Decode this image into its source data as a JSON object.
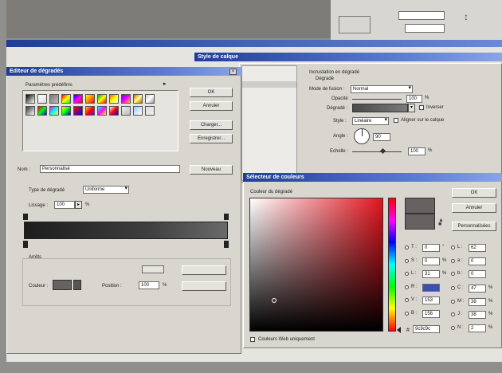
{
  "gradient_editor": {
    "title": "Editeur de dégradés",
    "presets_label": "Paramètres prédéfinis",
    "buttons": {
      "ok": "OK",
      "cancel": "Annuler",
      "load": "Charger...",
      "save": "Enregistrer..."
    },
    "name_label": "Nom :",
    "name_value": "Personnalisé",
    "new_button": "Nouveau",
    "gradient_type_label": "Type de dégradé",
    "gradient_type_value": "Uniforme",
    "smoothness_label": "Lissage :",
    "smoothness_value": "100",
    "smoothness_unit": "%",
    "stops_label": "Arrêts",
    "color_label": "Couleur :",
    "position_label": "Position :",
    "position_value": "100",
    "position_unit": "%"
  },
  "layer_style": {
    "title": "Style de calque",
    "section_title": "Incrustation en dégradé",
    "sub_title": "Dégradé",
    "blend_label": "Mode de fusion :",
    "blend_value": "Normal",
    "opacity_label": "Opacité :",
    "opacity_value": "100",
    "opacity_unit": "%",
    "gradient_label": "Dégradé :",
    "reverse_label": "Inverser",
    "style_label": "Style :",
    "style_value": "Linéaire",
    "align_label": "Aligner sur le calque",
    "angle_label": "Angle :",
    "angle_value": "90",
    "scale_label": "Echelle :",
    "scale_value": "100",
    "scale_unit": "%"
  },
  "color_picker": {
    "title": "Sélecteur de couleurs",
    "subtitle": "Couleur du dégradé",
    "buttons": {
      "ok": "OK",
      "cancel": "Annuler",
      "custom": "Personnalisées"
    },
    "web_only_label": "Couleurs Web uniquement",
    "fields": {
      "H": {
        "label": "T :",
        "value": "0",
        "unit": "°"
      },
      "S": {
        "label": "S :",
        "value": "0",
        "unit": "%"
      },
      "B": {
        "label": "L :",
        "value": "31",
        "unit": "%"
      },
      "R": {
        "label": "R :",
        "value": "",
        "unit": ""
      },
      "G": {
        "label": "V :",
        "value": "153",
        "unit": ""
      },
      "Bl": {
        "label": "B :",
        "value": "156",
        "unit": ""
      },
      "L": {
        "label": "L :",
        "value": "62",
        "unit": ""
      },
      "a": {
        "label": "a :",
        "value": "0",
        "unit": ""
      },
      "b": {
        "label": "b :",
        "value": "0",
        "unit": ""
      },
      "C": {
        "label": "C :",
        "value": "47",
        "unit": "%"
      },
      "M": {
        "label": "M :",
        "value": "38",
        "unit": "%"
      },
      "J": {
        "label": "J :",
        "value": "38",
        "unit": "%"
      },
      "N": {
        "label": "N :",
        "value": "2",
        "unit": "%"
      }
    },
    "hex_label": "#",
    "hex_value": "9c9c9c",
    "colors": {
      "new_swatch": "#666262",
      "current_swatch": "#666262"
    }
  },
  "colors": {
    "title_blue": "#1f3c99",
    "panel": "#d9d6cf",
    "desktop": "#8f8f8d"
  }
}
